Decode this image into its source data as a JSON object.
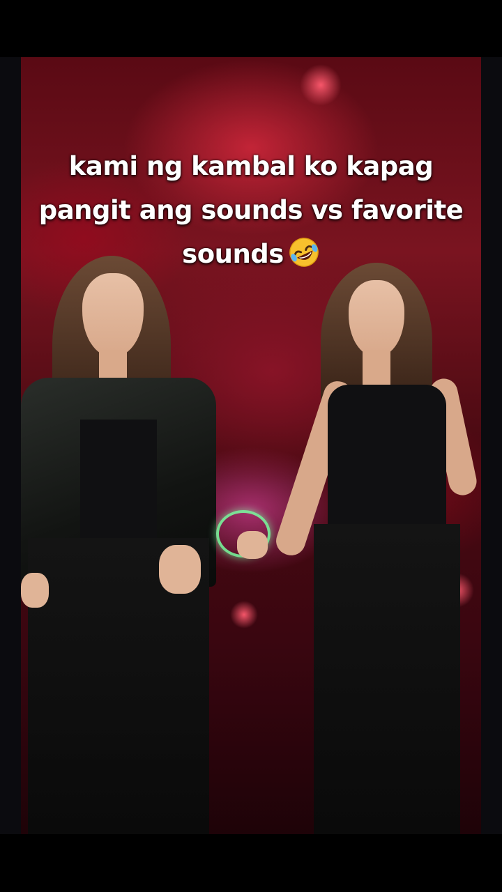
{
  "caption": {
    "line1": "kami ng kambal ko kapag",
    "line2": "pangit ang sounds vs favorite",
    "line3": "sounds",
    "emoji_icon": "rolling-on-floor-laughing-emoji"
  },
  "colors": {
    "background": "#000000",
    "scene_red": "#7a1420",
    "caption_text": "#ffffff"
  }
}
